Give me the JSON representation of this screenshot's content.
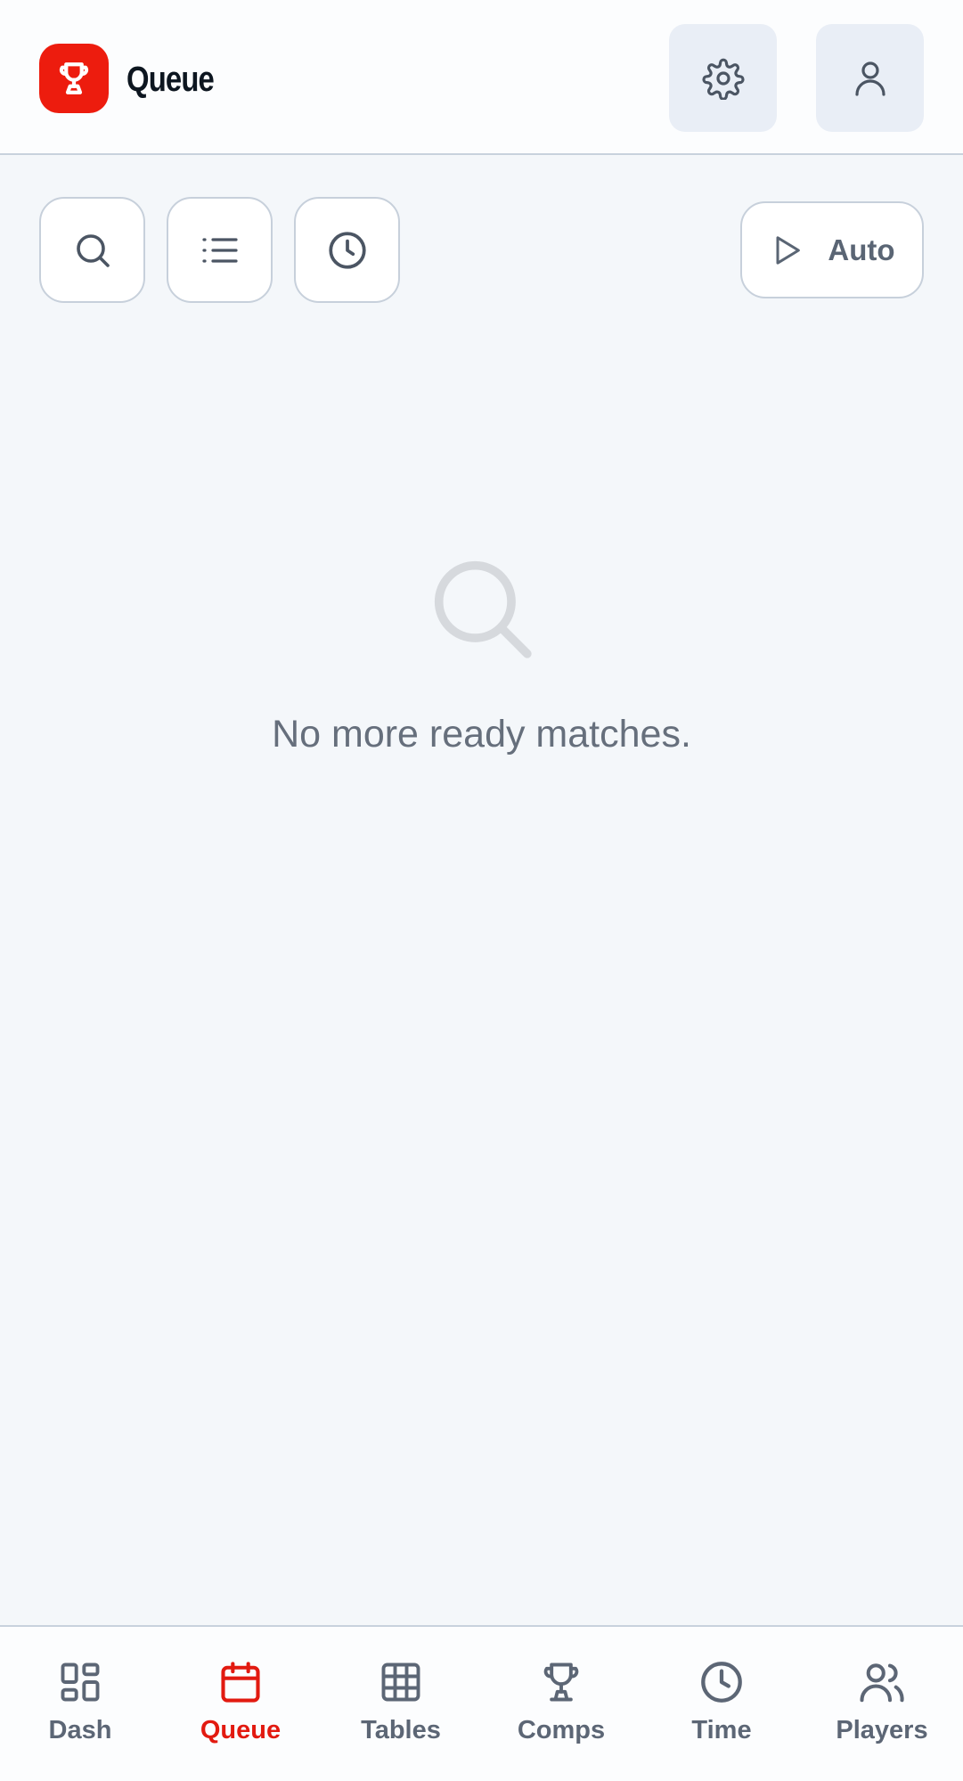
{
  "header": {
    "title": "Queue",
    "logo_icon": "trophy-icon",
    "brand_color": "#ed1c0e",
    "settings_icon": "gear-icon",
    "profile_icon": "user-icon"
  },
  "toolbar": {
    "search_icon": "search-icon",
    "list_icon": "list-icon",
    "history_icon": "clock-icon",
    "auto_label": "Auto",
    "auto_icon": "play-icon"
  },
  "empty_state": {
    "icon": "search-icon",
    "message": "No more ready matches."
  },
  "bottom_nav": {
    "active_color": "#e21a10",
    "items": [
      {
        "label": "Dash",
        "icon": "dashboard-icon",
        "active": false
      },
      {
        "label": "Queue",
        "icon": "calendar-icon",
        "active": true
      },
      {
        "label": "Tables",
        "icon": "grid-icon",
        "active": false
      },
      {
        "label": "Comps",
        "icon": "trophy-icon",
        "active": false
      },
      {
        "label": "Time",
        "icon": "clock-icon",
        "active": false
      },
      {
        "label": "Players",
        "icon": "users-icon",
        "active": false
      }
    ]
  }
}
